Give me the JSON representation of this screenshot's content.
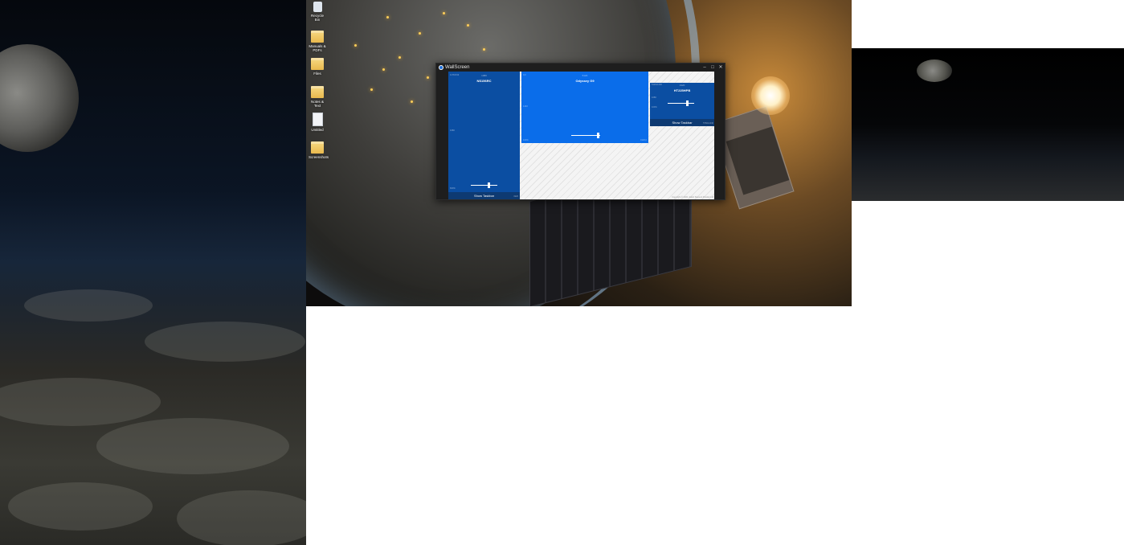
{
  "desktop": {
    "icons": [
      {
        "label": "Recycle Bin",
        "icon": "recycle-bin-icon"
      },
      {
        "label": "Manuals & PDFs",
        "icon": "folder-icon"
      },
      {
        "label": "Files",
        "icon": "folder-icon"
      },
      {
        "label": "Notes & Text",
        "icon": "folder-icon"
      },
      {
        "label": "Untitled",
        "icon": "document-icon"
      },
      {
        "label": "Screenshots",
        "icon": "folder-icon"
      }
    ]
  },
  "window": {
    "title": "WallScreen",
    "minimize": "–",
    "maximize": "□",
    "close": "✕"
  },
  "monitors": [
    {
      "name": "NS156RC",
      "resolution": "1080",
      "top_left": "1178x519",
      "left_edge": "1080",
      "bottom_left": "600%",
      "bottom_right": "1920",
      "slider_value": 0.65,
      "taskbar": "Show Taskbar",
      "color": "#0b4ea2"
    },
    {
      "name": "Odyssey G9",
      "resolution": "5120",
      "top_left": "0,0",
      "left_edge": "1440",
      "bottom_left": "100%",
      "bottom_right": "1920,0",
      "slider_value": 0.92,
      "color": "#0a6dea"
    },
    {
      "name": "HT225HPB",
      "resolution": "1920",
      "top_left": "5120x1440",
      "left_edge": "1080",
      "bottom_left": "100%",
      "slider_value": 0.68,
      "taskbar": "Show Taskbar",
      "bottom_right": "5760x1440",
      "color": "#0b4ea2"
    }
  ],
  "footer": "Copyright © 2021 Jakob Stepeck Powder Ltd",
  "colors": {
    "window_bg": "#1e1e1e",
    "accent": "#0a6dea",
    "secondary": "#0b4ea2"
  }
}
